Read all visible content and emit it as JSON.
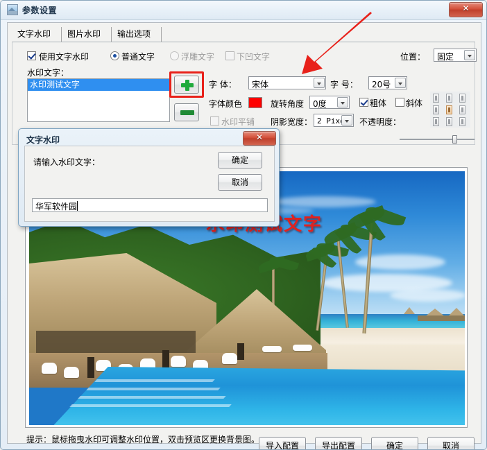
{
  "window": {
    "title": "参数设置",
    "close_label": "✕",
    "icon": "picture-icon"
  },
  "tabs": [
    {
      "label": "文字水印",
      "active": true
    },
    {
      "label": "图片水印",
      "active": false
    },
    {
      "label": "输出选项",
      "active": false
    }
  ],
  "options": {
    "use_text_watermark": {
      "label": "使用文字水印",
      "checked": true,
      "enabled": true
    },
    "normal_text": {
      "label": "普通文字",
      "selected": true,
      "enabled": true
    },
    "emboss_text": {
      "label": "浮雕文字",
      "selected": false,
      "enabled": false
    },
    "engrave_text": {
      "label": "下凹文字",
      "checked": false,
      "enabled": false
    },
    "watermark_text_label": "水印文字：",
    "watermark_list": [
      "水印测试文字"
    ],
    "watermark_list_selected": "水印测试文字",
    "add_button": "add-plus-button",
    "remove_button": "remove-minus-button",
    "font_family": {
      "label": "字  体：",
      "value": "宋体"
    },
    "font_size": {
      "label": "字  号：",
      "value": "20号"
    },
    "font_color": {
      "label": "字体颜色",
      "value": "#FE0000"
    },
    "rotation": {
      "label": "旋转角度",
      "value": "0度"
    },
    "tile": {
      "label": "水印平铺",
      "checked": false,
      "enabled": false
    },
    "shadow_width": {
      "label": "阴影宽度：",
      "value": "2 Pixel"
    },
    "bold": {
      "label": "粗体",
      "checked": true
    },
    "italic": {
      "label": "斜体",
      "checked": false
    },
    "position": {
      "label": "位置：",
      "value": "固定"
    },
    "opacity": {
      "label": "不透明度：",
      "percent": 72
    },
    "align_grid": {
      "selected_index": 4,
      "cells": 9
    }
  },
  "preview": {
    "watermark_text": "水印测试文字",
    "watermark_color": "#E0221F",
    "scene": "tropical-resort-pool"
  },
  "footer": {
    "hint": "提示：鼠标拖曳水印可调整水印位置，双击预览区更换背景图。",
    "buttons": [
      {
        "label": "导入配置"
      },
      {
        "label": "导出配置"
      },
      {
        "label": "确定"
      },
      {
        "label": "取消"
      }
    ]
  },
  "modal": {
    "title": "文字水印",
    "close_label": "✕",
    "prompt": "请输入水印文字：",
    "ok_label": "确定",
    "cancel_label": "取消",
    "input_value": "华军软件园"
  },
  "annotation": {
    "arrow": "red-arrow-pointing-to-add-button",
    "arrow_color": "#E8211A",
    "highlight_box_color": "#E8211A"
  }
}
